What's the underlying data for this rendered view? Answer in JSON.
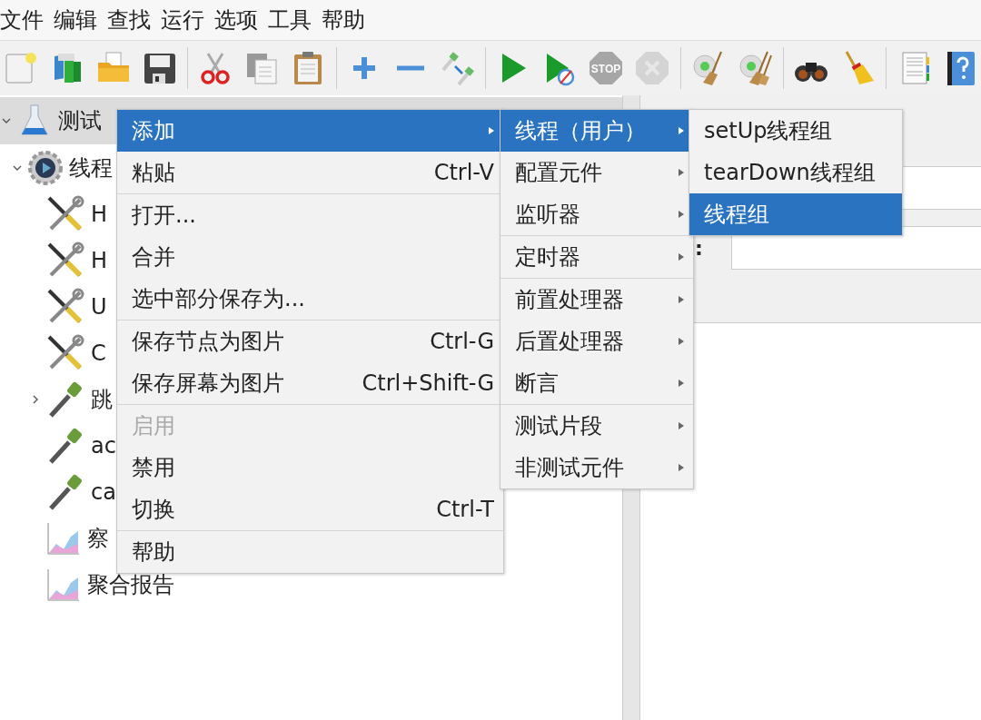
{
  "menubar": [
    {
      "label": "文件"
    },
    {
      "label": "编辑"
    },
    {
      "label": "查找"
    },
    {
      "label": "运行"
    },
    {
      "label": "选项"
    },
    {
      "label": "工具"
    },
    {
      "label": "帮助"
    }
  ],
  "toolbar": [
    {
      "kind": "new",
      "disabled": false
    },
    {
      "kind": "templates",
      "disabled": false
    },
    {
      "kind": "open",
      "disabled": false
    },
    {
      "kind": "save",
      "disabled": false
    },
    {
      "kind": "separator"
    },
    {
      "kind": "cut",
      "disabled": false
    },
    {
      "kind": "copy",
      "disabled": false
    },
    {
      "kind": "paste",
      "disabled": false
    },
    {
      "kind": "separator"
    },
    {
      "kind": "expand",
      "disabled": false
    },
    {
      "kind": "collapse",
      "disabled": false
    },
    {
      "kind": "toggle",
      "disabled": false
    },
    {
      "kind": "separator"
    },
    {
      "kind": "start",
      "disabled": false
    },
    {
      "kind": "start-no-timers",
      "disabled": false
    },
    {
      "kind": "stop",
      "disabled": true,
      "label": "STOP"
    },
    {
      "kind": "shutdown",
      "disabled": true
    },
    {
      "kind": "separator"
    },
    {
      "kind": "clear",
      "disabled": false
    },
    {
      "kind": "clear-all",
      "disabled": false
    },
    {
      "kind": "separator"
    },
    {
      "kind": "search",
      "disabled": false
    },
    {
      "kind": "reset-search",
      "disabled": false
    },
    {
      "kind": "separator"
    },
    {
      "kind": "function-helper",
      "disabled": false
    },
    {
      "kind": "help",
      "disabled": false
    }
  ],
  "tree": {
    "label": "测试",
    "kind": "test-plan",
    "expanded": true,
    "selected": true,
    "children": [
      {
        "label": "线程",
        "kind": "thread-group",
        "expanded": true,
        "selected": false,
        "children": [
          {
            "label": "H",
            "kind": "sampler",
            "selected": false
          },
          {
            "label": "H",
            "kind": "sampler",
            "selected": false
          },
          {
            "label": "U",
            "kind": "sampler",
            "selected": false
          },
          {
            "label": "C",
            "kind": "sampler",
            "selected": false
          },
          {
            "label": "跳",
            "kind": "extractor",
            "expanded": false,
            "selected": false
          },
          {
            "label": "ac",
            "kind": "extractor",
            "selected": false
          },
          {
            "label": "ca",
            "kind": "extractor",
            "selected": false
          },
          {
            "label": "察",
            "kind": "listener",
            "selected": false
          },
          {
            "label": "聚合报告",
            "kind": "listener",
            "selected": false
          }
        ]
      }
    ]
  },
  "context_menu": {
    "items": [
      {
        "kind": "item",
        "label": "添加",
        "submenu": true,
        "selected": true,
        "disabled": false
      },
      {
        "kind": "item",
        "label": "粘贴",
        "shortcut": "Ctrl-V",
        "submenu": false,
        "selected": false,
        "disabled": false
      },
      {
        "kind": "separator"
      },
      {
        "kind": "item",
        "label": "打开...",
        "submenu": false,
        "selected": false,
        "disabled": false
      },
      {
        "kind": "item",
        "label": "合并",
        "submenu": false,
        "selected": false,
        "disabled": false
      },
      {
        "kind": "item",
        "label": "选中部分保存为...",
        "submenu": false,
        "selected": false,
        "disabled": false
      },
      {
        "kind": "separator"
      },
      {
        "kind": "item",
        "label": "保存节点为图片",
        "shortcut": "Ctrl-G",
        "submenu": false,
        "selected": false,
        "disabled": false
      },
      {
        "kind": "item",
        "label": "保存屏幕为图片",
        "shortcut": "Ctrl+Shift-G",
        "submenu": false,
        "selected": false,
        "disabled": false
      },
      {
        "kind": "separator"
      },
      {
        "kind": "item",
        "label": "启用",
        "submenu": false,
        "selected": false,
        "disabled": true
      },
      {
        "kind": "item",
        "label": "禁用",
        "submenu": false,
        "selected": false,
        "disabled": false
      },
      {
        "kind": "item",
        "label": "切换",
        "shortcut": "Ctrl-T",
        "submenu": false,
        "selected": false,
        "disabled": false
      },
      {
        "kind": "separator"
      },
      {
        "kind": "item",
        "label": "帮助",
        "submenu": false,
        "selected": false,
        "disabled": false
      }
    ]
  },
  "add_submenu": {
    "items": [
      {
        "kind": "item",
        "label": "线程（用户）",
        "submenu": true,
        "selected": true,
        "disabled": false
      },
      {
        "kind": "item",
        "label": "配置元件",
        "submenu": true,
        "selected": false,
        "disabled": false
      },
      {
        "kind": "item",
        "label": "监听器",
        "submenu": true,
        "selected": false,
        "disabled": false
      },
      {
        "kind": "separator"
      },
      {
        "kind": "item",
        "label": "定时器",
        "submenu": true,
        "selected": false,
        "disabled": false
      },
      {
        "kind": "separator"
      },
      {
        "kind": "item",
        "label": "前置处理器",
        "submenu": true,
        "selected": false,
        "disabled": false
      },
      {
        "kind": "item",
        "label": "后置处理器",
        "submenu": true,
        "selected": false,
        "disabled": false
      },
      {
        "kind": "item",
        "label": "断言",
        "submenu": true,
        "selected": false,
        "disabled": false
      },
      {
        "kind": "separator"
      },
      {
        "kind": "item",
        "label": "测试片段",
        "submenu": true,
        "selected": false,
        "disabled": false
      },
      {
        "kind": "item",
        "label": "非测试元件",
        "submenu": true,
        "selected": false,
        "disabled": false
      }
    ]
  },
  "threads_submenu": {
    "items": [
      {
        "kind": "item",
        "label": "setUp线程组",
        "submenu": false,
        "selected": false,
        "disabled": false
      },
      {
        "kind": "item",
        "label": "tearDown线程组",
        "submenu": false,
        "selected": false,
        "disabled": false
      },
      {
        "kind": "item",
        "label": "线程组",
        "submenu": false,
        "selected": true,
        "disabled": false
      }
    ]
  },
  "right_panel": {
    "field_label": ":"
  }
}
